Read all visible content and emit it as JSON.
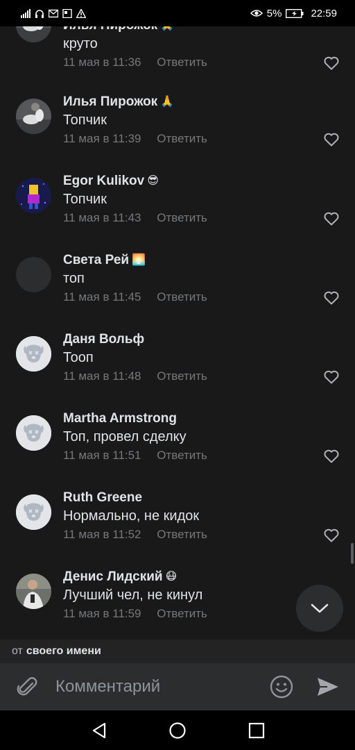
{
  "status_bar": {
    "left_icons": [
      "signal-icon",
      "headset-icon",
      "mail-icon",
      "image-icon",
      "warning-icon"
    ],
    "battery_percent": "5%",
    "time": "22:59"
  },
  "comments": [
    {
      "name": "Илья Пирожок",
      "emoji": "🙏",
      "text": "круто",
      "date": "11 мая в 11:36",
      "reply": "Ответить",
      "avatar": "photo-avatar"
    },
    {
      "name": "Илья Пирожок",
      "emoji": "🙏",
      "text": "Топчик",
      "date": "11 мая в 11:39",
      "reply": "Ответить",
      "avatar": "photo-avatar"
    },
    {
      "name": "Egor Kulikov",
      "emoji": "😎",
      "text": "Топчик",
      "date": "11 мая в 11:43",
      "reply": "Ответить",
      "avatar": "cartoon-avatar"
    },
    {
      "name": "Света Рей",
      "emoji": "🌅",
      "text": "топ",
      "date": "11 мая в 11:45",
      "reply": "Ответить",
      "avatar": "empty-avatar"
    },
    {
      "name": "Даня Вольф",
      "emoji": "",
      "text": "Тооп",
      "date": "11 мая в 11:48",
      "reply": "Ответить",
      "avatar": "deleted-dog-avatar"
    },
    {
      "name": "Martha Armstrong",
      "emoji": "",
      "text": "Топ, провел сделку",
      "date": "11 мая в 11:51",
      "reply": "Ответить",
      "avatar": "deleted-dog-avatar"
    },
    {
      "name": "Ruth Greene",
      "emoji": "",
      "text": "Нормально, не кидок",
      "date": "11 мая в 11:52",
      "reply": "Ответить",
      "avatar": "deleted-dog-avatar"
    },
    {
      "name": "Денис Лидский",
      "emoji": "😷",
      "text": "Лучший чел, не кинул",
      "date": "11 мая в 11:59",
      "reply": "Ответить",
      "avatar": "photo-avatar"
    }
  ],
  "from_bar": {
    "prefix": "от",
    "name": "своего имени"
  },
  "composer": {
    "placeholder": "Комментарий"
  },
  "colors": {
    "background": "#19191a",
    "secondary_text": "#76787a",
    "panel": "#2c2d2e"
  }
}
